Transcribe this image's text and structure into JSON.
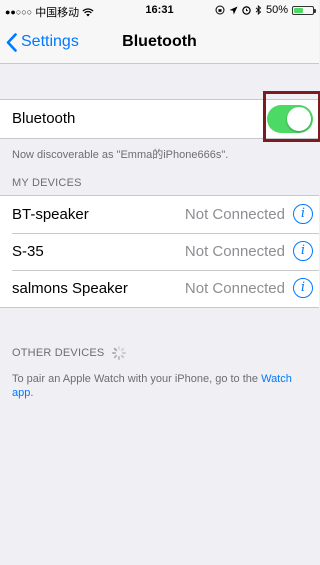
{
  "status_bar": {
    "signal": "●●○○○",
    "carrier": "中国移动",
    "wifi_icon": "wifi-icon",
    "time": "16:31",
    "battery_percent": "50%",
    "battery_level": 0.5,
    "battery_color": "#4cd964"
  },
  "nav": {
    "back_label": "Settings",
    "title": "Bluetooth"
  },
  "bluetooth": {
    "label": "Bluetooth",
    "enabled": true,
    "toggle_color": "#4cd964",
    "discoverable_text": "Now discoverable as \"Emma的iPhone666s\"."
  },
  "my_devices": {
    "header": "MY DEVICES",
    "items": [
      {
        "name": "BT-speaker",
        "status": "Not Connected"
      },
      {
        "name": "S-35",
        "status": "Not Connected"
      },
      {
        "name": "salmons Speaker",
        "status": "Not Connected"
      }
    ]
  },
  "other_devices": {
    "header": "OTHER DEVICES",
    "pair_text": "To pair an Apple Watch with your iPhone, go to the",
    "watch_link": "Watch app."
  },
  "colors": {
    "accent": "#007aff",
    "highlight_border": "#7a1c20",
    "background": "#efeff4"
  }
}
